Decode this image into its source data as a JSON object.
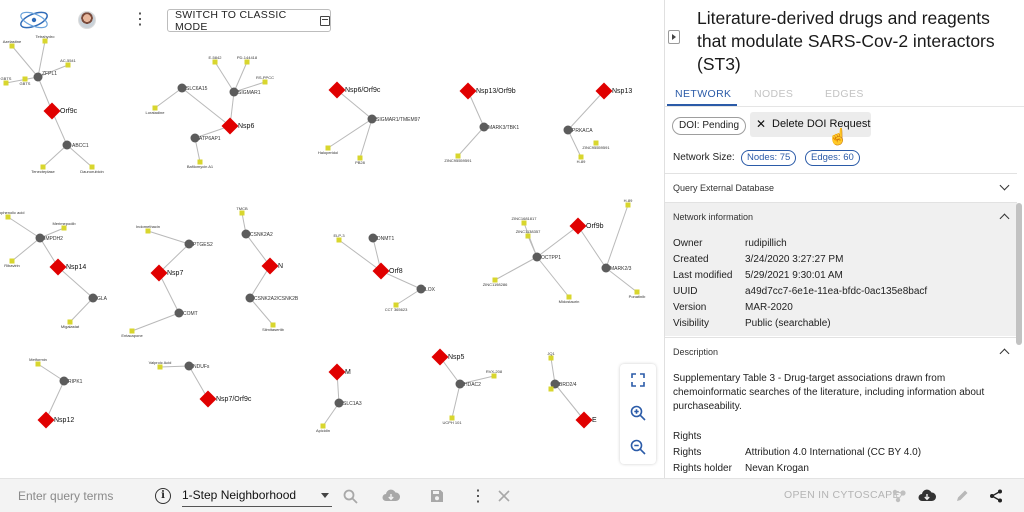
{
  "top_bar": {
    "classic_mode_label": "SWITCH TO CLASSIC MODE"
  },
  "graph": {
    "red_nodes": [
      "Orf9c",
      "Nsp6",
      "Nsp6/Orf9c",
      "Nsp13/Orf9b",
      "Nsp13",
      "Nsp14",
      "Nsp7",
      "N",
      "Orf8",
      "Orf9b",
      "Nsp12",
      "Nsp7/Orf9c",
      "M",
      "Nsp5",
      "E"
    ],
    "gray_labels": [
      "ZFPL1",
      "ABCC1",
      "SLC6A15",
      "SIGMAR1",
      "ATP6AP1",
      "SIGMAR1/TMEM97",
      "MARK3/TBK1",
      "PRKACA",
      "IMPDH2",
      "GLA",
      "PTGES2",
      "COMT",
      "CSNK2A2",
      "CSNK2A2/CSNK2B",
      "DNMT1",
      "LOX",
      "OCTPP1",
      "MARK2/3",
      "RIPK1",
      "NDUFs",
      "SLC1A3",
      "HDAC2",
      "BRD2/4"
    ],
    "yellow_labels": [
      "Azelastine",
      "Tetrahydro",
      "AC-5541",
      "GBTS",
      "Tenecteplase",
      "Daunorubicin",
      "E-5842",
      "PD-144418",
      "RS-PPCC",
      "Loratadine",
      "Bafilomycin A1",
      "Haloperidol",
      "PB28",
      "ZINC95559591",
      "H-89",
      "Mycophenolic acid",
      "Merimepodib",
      "Ribavirin",
      "Migalastat",
      "Indomethacin",
      "Entacapone",
      "TMCB",
      "Silmitasertib",
      "ELP-3",
      "CCT 365623",
      "ZINC95559591",
      "ZINC1681817",
      "ZINC1138357",
      "ZINC1198286",
      "Midostaurin",
      "H-89",
      "Ponatinib",
      "Metformin",
      "Valproic Acid",
      "Apicidin",
      "UCPH 101",
      "RVX-208",
      "JQ1"
    ]
  },
  "zoom_tools": {
    "fit_icon": "fit-screen-icon",
    "zoom_in_icon": "zoom-in-icon",
    "zoom_out_icon": "zoom-out-icon"
  },
  "bottom_bar": {
    "query_placeholder": "Enter query terms",
    "neighborhood_value": "1-Step Neighborhood",
    "open_cytoscape_label": "OPEN IN CYTOSCAPE"
  },
  "panel": {
    "title": "Literature-derived drugs and reagents that modulate SARS-Cov-2 interactors (ST3)",
    "tabs": [
      {
        "label": "NETWORK"
      },
      {
        "label": "NODES"
      },
      {
        "label": "EDGES"
      }
    ],
    "doi_status": "DOI: Pending",
    "delete_doi_label": "Delete DOI Request",
    "network_size_label": "Network Size:",
    "nodes_chip": "Nodes: 75",
    "edges_chip": "Edges: 60",
    "query_external_label": "Query External Database",
    "network_info_label": "Network information",
    "info_rows": [
      {
        "key": "Owner",
        "value": "rudipillich"
      },
      {
        "key": "Created",
        "value": "3/24/2020 3:27:27 PM"
      },
      {
        "key": "Last modified",
        "value": "5/29/2021 9:30:01 AM"
      },
      {
        "key": "UUID",
        "value": "a49d7cc7-6e1e-11ea-bfdc-0ac135e8bacf"
      },
      {
        "key": "Version",
        "value": "MAR-2020"
      },
      {
        "key": "Visibility",
        "value": "Public (searchable)"
      }
    ],
    "description_label": "Description",
    "description_text": "Supplementary Table 3 - Drug-target associations drawn from chemoinformatic searches of the literature, including information about purchaseability.",
    "rights_header": "Rights",
    "rights_rows": [
      {
        "key": "Rights",
        "value": "Attribution 4.0 International (CC BY 4.0)"
      },
      {
        "key": "Rights holder",
        "value": "Nevan Krogan"
      }
    ]
  },
  "colors": {
    "accent": "#2b5ba8",
    "target_node": "#e00000",
    "protein_node": "#5c5c5c",
    "drug_node": "#d8d62e"
  }
}
